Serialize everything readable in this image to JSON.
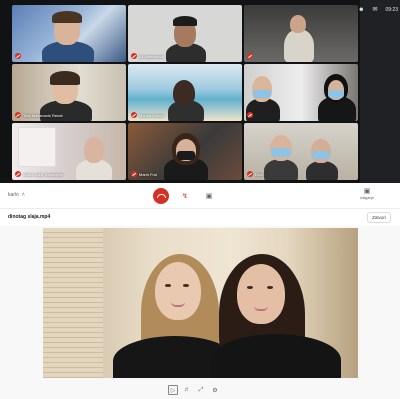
{
  "meeting": {
    "tiles": [
      {
        "name": ""
      },
      {
        "name": "Ali Arsenovich"
      },
      {
        "name": ""
      },
      {
        "name": "Tina Mašanović Reizić"
      },
      {
        "name": "Marina Deličić"
      },
      {
        "name": ""
      },
      {
        "name": "Antoa Jukić Kovačević"
      },
      {
        "name": "Marin Frol"
      },
      {
        "name": "Lina"
      }
    ],
    "top_icons": {
      "clock": "09:23"
    }
  },
  "controls": {
    "left_label": "karlo",
    "right_label": "Izlaganje"
  },
  "file": {
    "name": "dinotag slaja.mp4",
    "close_label": "Zatvori"
  },
  "colors": {
    "end_call": "#d93025",
    "background": "#ffffff",
    "meeting_bg": "#111214"
  }
}
